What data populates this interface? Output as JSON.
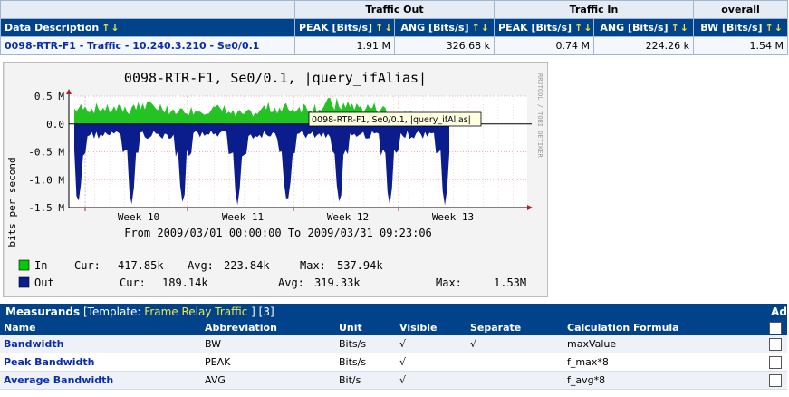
{
  "summary": {
    "groups": {
      "traffic_out": "Traffic Out",
      "traffic_in": "Traffic In",
      "overall": "overall"
    },
    "columns": {
      "description": "Data Description",
      "out_peak": "PEAK [Bits/s]",
      "out_avg": "ANG [Bits/s]",
      "in_peak": "PEAK [Bits/s]",
      "in_avg": "ANG [Bits/s]",
      "bw": "BW [Bits/s]"
    },
    "sort_arrows": "↑↓",
    "row": {
      "description": "0098-RTR-F1 - Traffic - 10.240.3.210 - Se0/0.1",
      "out_peak": "1.91 M",
      "out_avg": "326.68 k",
      "in_peak": "0.74 M",
      "in_avg": "224.26 k",
      "bw": "1.54 M"
    }
  },
  "graph": {
    "title": "0098-RTR-F1, Se0/0.1, |query_ifAlias|",
    "ylabel": "bits per second",
    "side_label": "RRDTOOL / TOBI OETIKER",
    "tooltip": "0098-RTR-F1, Se0/0.1, |query_ifAlias|",
    "range_text": "From 2009/03/01 00:00:00 To 2009/03/31 09:23:06",
    "legend": [
      {
        "name": "In",
        "color": "#00cc00",
        "cur_label": "Cur:",
        "cur": "417.85k",
        "avg_label": "Avg:",
        "avg": "223.84k",
        "max_label": "Max:",
        "max": "537.94k"
      },
      {
        "name": "Out",
        "color": "#0a1d8f",
        "cur_label": "Cur:",
        "cur": "189.14k",
        "avg_label": "Avg:",
        "avg": "319.33k",
        "max_label": "Max:",
        "max": "1.53M"
      }
    ],
    "colors": {
      "in": "#22c322",
      "out": "#0b1c8c",
      "grid": "#e8a0a0",
      "axis": "#000000",
      "frame": "#b02020"
    }
  },
  "chart_data": {
    "type": "area",
    "title": "0098-RTR-F1, Se0/0.1, |query_ifAlias|",
    "ylabel": "bits per second",
    "ylim": [
      -1.5,
      0.5
    ],
    "yticks": [
      "0.5 M",
      "0.0",
      "-0.5 M",
      "-1.0 M",
      "-1.5 M"
    ],
    "categories": [
      "Week 10",
      "Week 11",
      "Week 12",
      "Week 13"
    ],
    "series": [
      {
        "name": "In",
        "values": [
          0.32,
          0.3,
          0.36,
          0.28,
          0.3,
          0.22,
          0.33,
          0.35,
          0.4,
          0.34,
          0.2,
          0.05
        ]
      },
      {
        "name": "Out",
        "values": [
          -0.12,
          -1.48,
          -0.2,
          -1.48,
          -0.18,
          -1.48,
          -0.25,
          -1.48,
          -0.2,
          -1.48,
          -0.15,
          -0.05
        ]
      }
    ]
  },
  "measurands": {
    "title": "Measurands",
    "template_prefix": "[Template:",
    "template_name": "Frame Relay Traffic",
    "template_suffix": "] [3]",
    "add_label": "Add",
    "columns": [
      "Name",
      "Abbreviation",
      "Unit",
      "Visible",
      "Separate",
      "Calculation Formula"
    ],
    "rows": [
      {
        "name": "Bandwidth",
        "abbr": "BW",
        "unit": "Bits/s",
        "visible": "√",
        "separate": "√",
        "formula": "maxValue"
      },
      {
        "name": "Peak Bandwidth",
        "abbr": "PEAK",
        "unit": "Bits/s",
        "visible": "√",
        "separate": "",
        "formula": "f_max*8"
      },
      {
        "name": "Average Bandwidth",
        "abbr": "AVG",
        "unit": "Bit/s",
        "visible": "√",
        "separate": "",
        "formula": "f_avg*8"
      }
    ]
  }
}
